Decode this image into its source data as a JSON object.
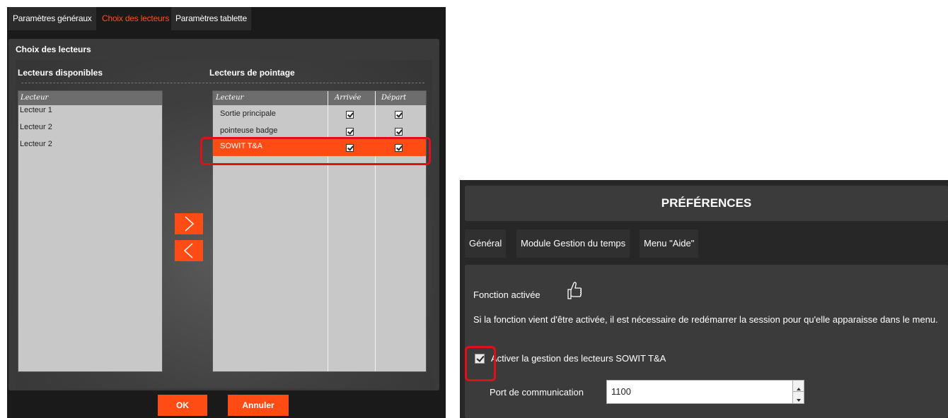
{
  "left": {
    "tabs": [
      {
        "label": "Paramètres généraux"
      },
      {
        "label": "Choix des lecteurs"
      },
      {
        "label": "Paramètres tablette"
      }
    ],
    "panel_title": "Choix des lecteurs",
    "available": {
      "title": "Lecteurs disponibles",
      "column": "Lecteur",
      "items": [
        "Lecteur 1",
        "Lecteur 2",
        "Lecteur 2"
      ]
    },
    "clocking": {
      "title": "Lecteurs de pointage",
      "columns": [
        "Lecteur",
        "Arrivée",
        "Départ"
      ],
      "rows": [
        {
          "name": "Sortie principale",
          "arrivee": true,
          "depart": true
        },
        {
          "name": "pointeuse badge",
          "arrivee": true,
          "depart": true
        },
        {
          "name": "SOWIT T&A",
          "arrivee": true,
          "depart": true,
          "selected": true
        }
      ]
    },
    "buttons": {
      "add": "arrow-right-icon",
      "remove": "arrow-left-icon",
      "ok": "OK",
      "cancel": "Annuler"
    },
    "accent_color": "#ff4b14",
    "highlight_color": "#e0101a"
  },
  "right": {
    "title": "PRÉFÉRENCES",
    "tabs": [
      {
        "label": "Général"
      },
      {
        "label": "Module Gestion du temps"
      },
      {
        "label": "Menu \"Aide\""
      }
    ],
    "function_label": "Fonction activée",
    "function_icon": "thumbs-up-icon",
    "info": "Si la fonction vient d'être activée, il est nécessaire de redémarrer la session pour qu'elle apparaisse dans le menu.",
    "activate_label": "Activer la gestion des lecteurs SOWIT T&A",
    "activate_checked": true,
    "port_label": "Port de communication",
    "port_value": "1100"
  }
}
